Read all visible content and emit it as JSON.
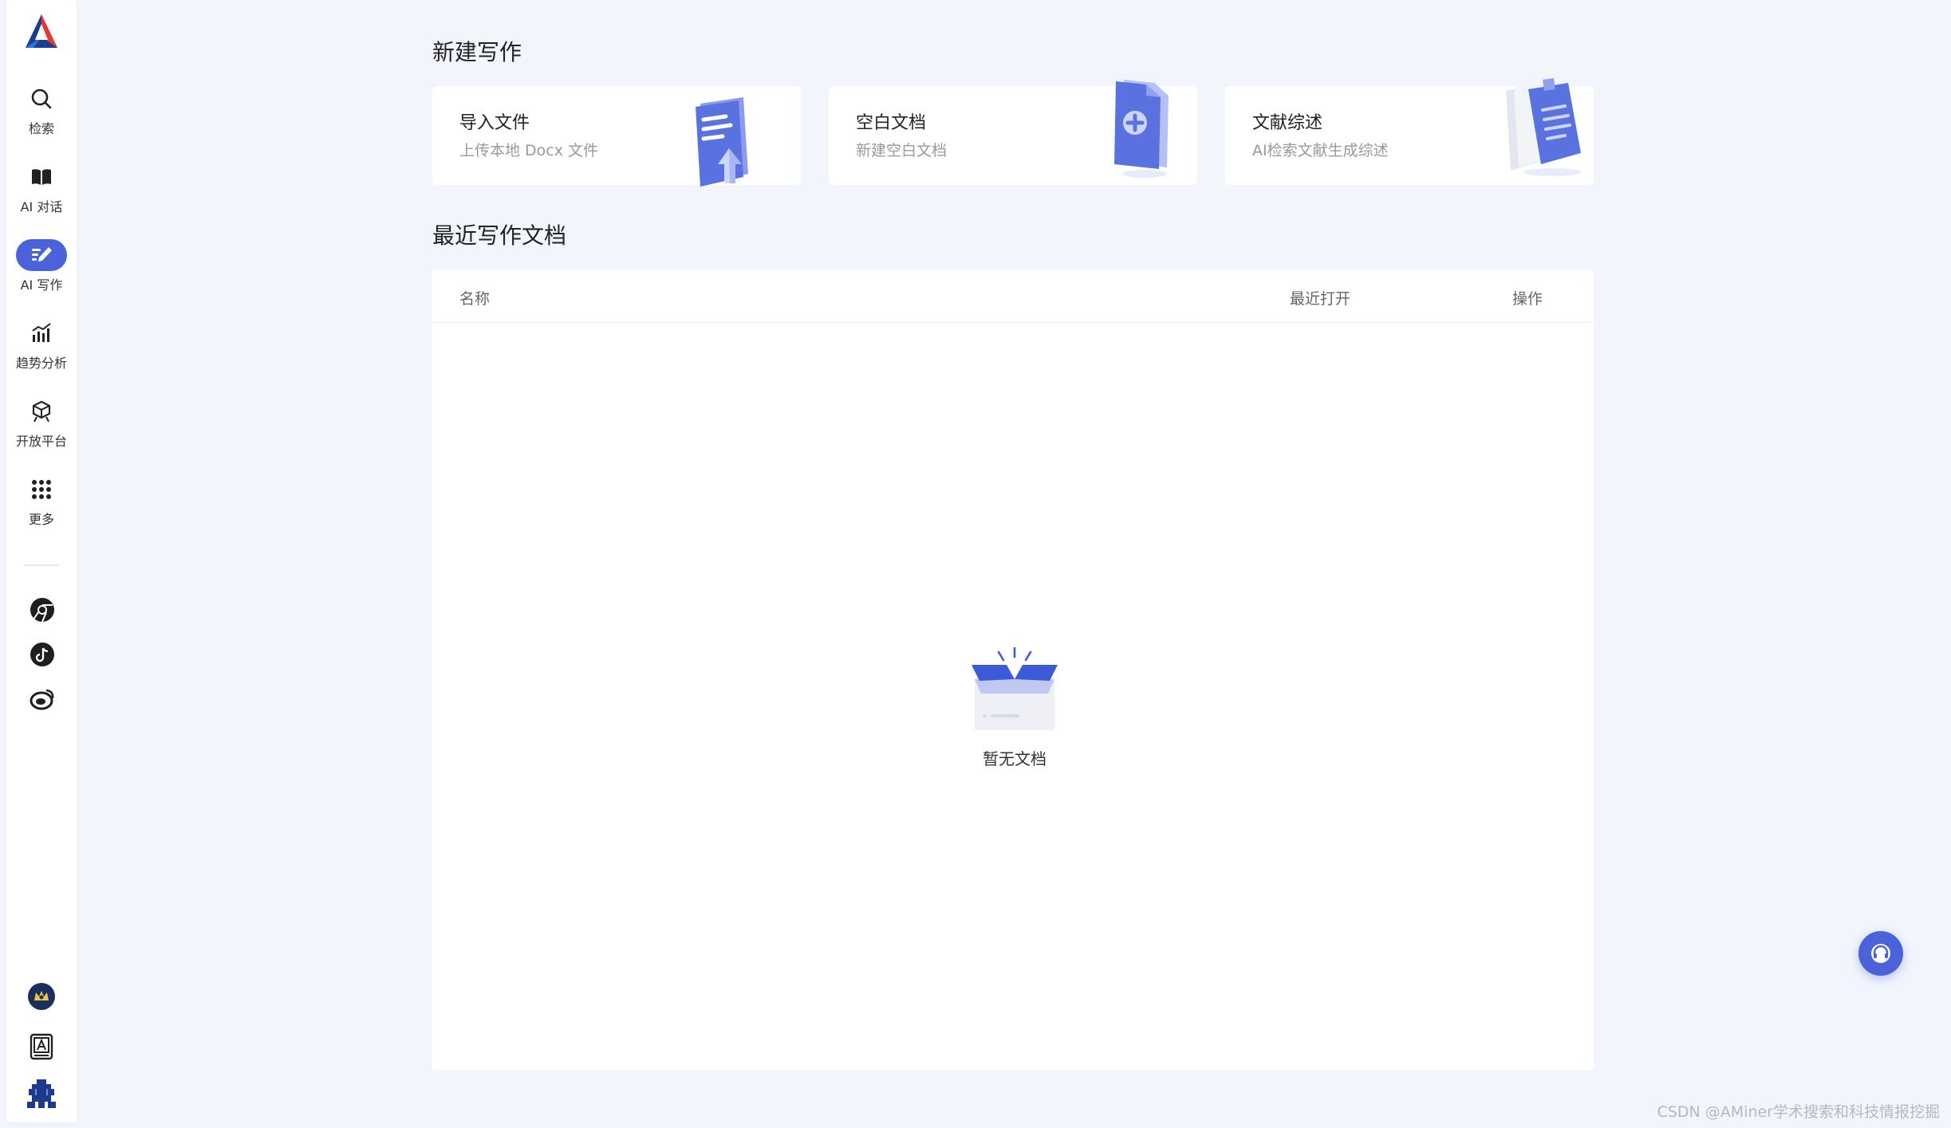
{
  "sidebar": {
    "items": [
      {
        "label": "检索",
        "icon": "search-icon"
      },
      {
        "label": "AI 对话",
        "icon": "book-icon"
      },
      {
        "label": "AI 写作",
        "icon": "write-icon"
      },
      {
        "label": "趋势分析",
        "icon": "trend-chart-icon"
      },
      {
        "label": "开放平台",
        "icon": "open-platform-icon"
      },
      {
        "label": "更多",
        "icon": "grid-dots-icon"
      }
    ],
    "active_item": "AI 写作",
    "external_icons": [
      "chrome-icon",
      "tiktok-icon",
      "weibo-icon"
    ],
    "bottom_icons": [
      "vip-crown-icon",
      "translate-doc-icon",
      "user-avatar-icon"
    ]
  },
  "new_writing": {
    "title": "新建写作",
    "cards": [
      {
        "title": "导入文件",
        "subtitle": "上传本地 Docx 文件",
        "icon": "import-doc-icon"
      },
      {
        "title": "空白文档",
        "subtitle": "新建空白文档",
        "icon": "blank-doc-icon"
      },
      {
        "title": "文献综述",
        "subtitle": "AI检索文献生成综述",
        "icon": "literature-review-icon"
      }
    ]
  },
  "recent_docs": {
    "title": "最近写作文档",
    "columns": {
      "name": "名称",
      "last_opened": "最近打开",
      "actions": "操作"
    },
    "rows": [],
    "empty_text": "暂无文档"
  },
  "watermark": "CSDN @AMiner学术搜索和科技情报挖掘",
  "colors": {
    "accent": "#4a63db",
    "background": "#f2f5fc"
  }
}
